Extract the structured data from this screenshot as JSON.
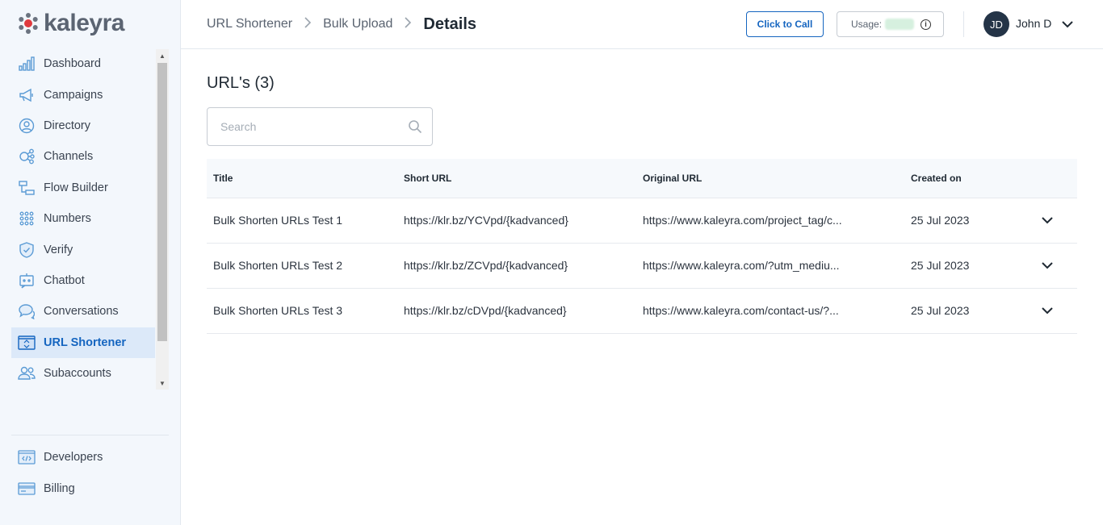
{
  "brand": {
    "name": "kaleyra",
    "accent": "#1565c0",
    "logo_mark_color": "#e03a3e"
  },
  "sidebar": {
    "items": [
      {
        "label": "Dashboard",
        "icon": "bar-chart-icon"
      },
      {
        "label": "Campaigns",
        "icon": "megaphone-icon"
      },
      {
        "label": "Directory",
        "icon": "user-circle-icon"
      },
      {
        "label": "Channels",
        "icon": "channels-icon"
      },
      {
        "label": "Flow Builder",
        "icon": "flow-builder-icon"
      },
      {
        "label": "Numbers",
        "icon": "dial-pad-icon"
      },
      {
        "label": "Verify",
        "icon": "shield-check-icon"
      },
      {
        "label": "Chatbot",
        "icon": "chatbot-icon"
      },
      {
        "label": "Conversations",
        "icon": "chat-bubbles-icon"
      },
      {
        "label": "URL Shortener",
        "icon": "link-icon",
        "active": true
      },
      {
        "label": "Subaccounts",
        "icon": "users-icon"
      }
    ],
    "bottom_items": [
      {
        "label": "Developers",
        "icon": "code-icon"
      },
      {
        "label": "Billing",
        "icon": "credit-card-icon"
      }
    ]
  },
  "header": {
    "breadcrumb": [
      "URL Shortener",
      "Bulk Upload"
    ],
    "current": "Details",
    "click_to_call": "Click to Call",
    "usage_label": "Usage:",
    "user_initials": "JD",
    "user_name": "John D"
  },
  "main": {
    "title": "URL's (3)",
    "search_placeholder": "Search",
    "columns": [
      "Title",
      "Short URL",
      "Original URL",
      "Created on"
    ],
    "rows": [
      {
        "title": "Bulk Shorten URLs Test 1",
        "short_url": "https://klr.bz/YCVpd/{kadvanced}",
        "original_url": "https://www.kaleyra.com/project_tag/c...",
        "created_on": "25 Jul 2023"
      },
      {
        "title": "Bulk Shorten URLs Test 2",
        "short_url": "https://klr.bz/ZCVpd/{kadvanced}",
        "original_url": "https://www.kaleyra.com/?utm_mediu...",
        "created_on": "25 Jul 2023"
      },
      {
        "title": "Bulk Shorten URLs Test 3",
        "short_url": "https://klr.bz/cDVpd/{kadvanced}",
        "original_url": "https://www.kaleyra.com/contact-us/?...",
        "created_on": "25 Jul 2023"
      }
    ]
  }
}
